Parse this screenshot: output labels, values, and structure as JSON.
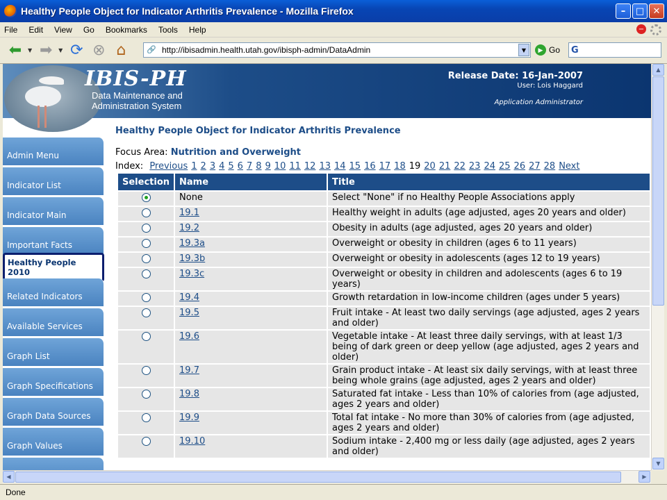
{
  "window": {
    "title": "Healthy People Object for Indicator Arthritis Prevalence - Mozilla Firefox"
  },
  "menu": [
    "File",
    "Edit",
    "View",
    "Go",
    "Bookmarks",
    "Tools",
    "Help"
  ],
  "toolbar": {
    "url": "http://ibisadmin.health.utah.gov/ibisph-admin/DataAdmin",
    "go_label": "Go",
    "search_logo": "G"
  },
  "banner": {
    "brand": "IBIS-PH",
    "subtitle_line1": "Data Maintenance and",
    "subtitle_line2": "Administration System",
    "release": "Release Date: 16-Jan-2007",
    "user": "User: Lois Haggard",
    "role": "Application Administrator"
  },
  "sidebar": {
    "items": [
      "Admin Menu",
      "Indicator List",
      "Indicator Main",
      "Important Facts",
      "Healthy People 2010",
      "Related Indicators",
      "Available Services",
      "Graph List",
      "Graph Specifications",
      "Graph Data Sources",
      "Graph Values"
    ],
    "active_index": 4
  },
  "main": {
    "page_title": "Healthy People Object for Indicator Arthritis Prevalence",
    "focus_label": "Focus Area:",
    "focus_value": "Nutrition and Overweight",
    "index_label": "Index:",
    "index_previous": "Previous",
    "index_numbers": [
      "1",
      "2",
      "3",
      "4",
      "5",
      "6",
      "7",
      "8",
      "9",
      "10",
      "11",
      "12",
      "13",
      "14",
      "15",
      "16",
      "17",
      "18",
      "19",
      "20",
      "21",
      "22",
      "23",
      "24",
      "25",
      "26",
      "27",
      "28"
    ],
    "index_current": "19",
    "index_next": "Next"
  },
  "table": {
    "headers": [
      "Selection",
      "Name",
      "Title"
    ],
    "rows": [
      {
        "selected": true,
        "name": "None",
        "link": false,
        "title": "Select \"None\" if no Healthy People Associations apply"
      },
      {
        "selected": false,
        "name": "19.1",
        "link": true,
        "title": "Healthy weight in adults (age adjusted, ages 20 years and older)"
      },
      {
        "selected": false,
        "name": "19.2",
        "link": true,
        "title": "Obesity in adults (age adjusted, ages 20 years and older)"
      },
      {
        "selected": false,
        "name": "19.3a",
        "link": true,
        "title": "Overweight or obesity in children (ages 6 to 11 years)"
      },
      {
        "selected": false,
        "name": "19.3b",
        "link": true,
        "title": "Overweight or obesity in adolescents (ages 12 to 19 years)"
      },
      {
        "selected": false,
        "name": "19.3c",
        "link": true,
        "title": "Overweight or obesity in children and adolescents (ages 6 to 19 years)"
      },
      {
        "selected": false,
        "name": "19.4",
        "link": true,
        "title": "Growth retardation in low-income children (ages under 5 years)"
      },
      {
        "selected": false,
        "name": "19.5",
        "link": true,
        "title": "Fruit intake - At least two daily servings (age adjusted, ages 2 years and older)"
      },
      {
        "selected": false,
        "name": "19.6",
        "link": true,
        "title": "Vegetable intake - At least three daily servings, with at least 1/3 being of dark green or deep yellow (age adjusted, ages 2 years and older)"
      },
      {
        "selected": false,
        "name": "19.7",
        "link": true,
        "title": "Grain product intake - At least six daily servings, with at least three being whole grains (age adjusted, ages 2 years and older)"
      },
      {
        "selected": false,
        "name": "19.8",
        "link": true,
        "title": "Saturated fat intake - Less than 10% of calories from (age adjusted, ages 2 years and older)"
      },
      {
        "selected": false,
        "name": "19.9",
        "link": true,
        "title": "Total fat intake - No more than 30% of calories from (age adjusted, ages 2 years and older)"
      },
      {
        "selected": false,
        "name": "19.10",
        "link": true,
        "title": "Sodium intake - 2,400 mg or less daily (age adjusted, ages 2 years and older)"
      }
    ]
  },
  "status": {
    "text": "Done"
  }
}
